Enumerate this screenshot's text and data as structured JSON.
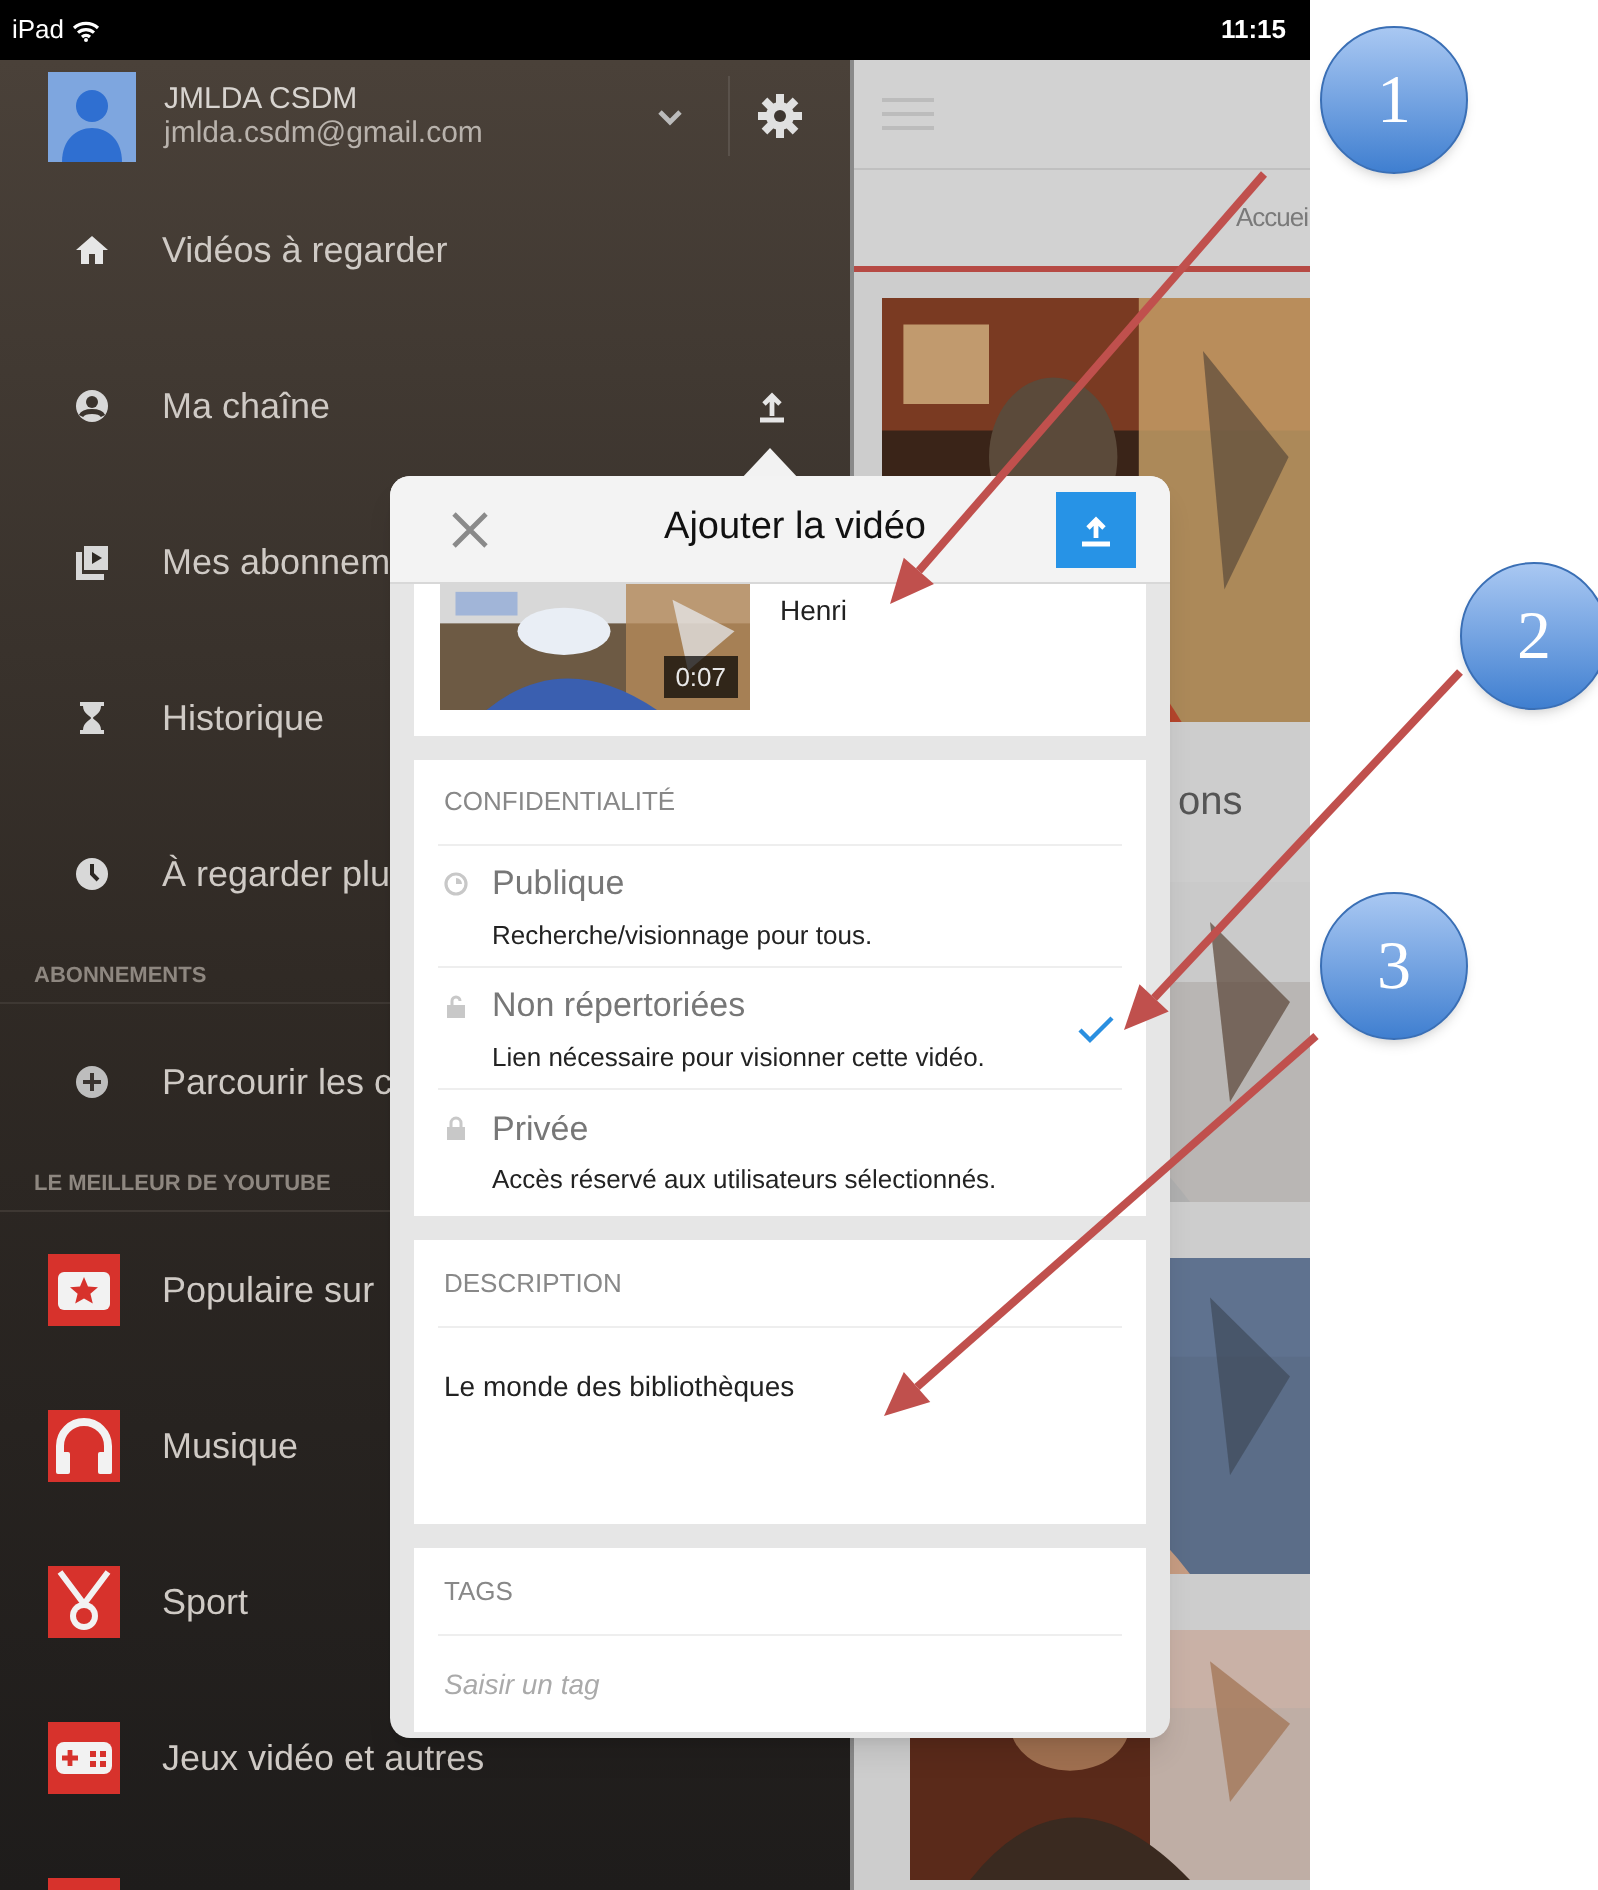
{
  "status_bar": {
    "device": "iPad",
    "time": "11:15"
  },
  "account": {
    "name": "JMLDA CSDM",
    "email": "jmlda.csdm@gmail.com"
  },
  "sidebar": {
    "items": [
      {
        "kind": "nav",
        "label": "Vidéos à regarder"
      },
      {
        "kind": "nav-upload",
        "label": "Ma chaîne"
      },
      {
        "kind": "nav",
        "label": "Mes abonnem"
      },
      {
        "kind": "nav",
        "label": "Historique"
      },
      {
        "kind": "nav",
        "label": "À regarder plu"
      },
      {
        "kind": "header",
        "label": "ABONNEMENTS"
      },
      {
        "kind": "nav",
        "label": "Parcourir les c"
      },
      {
        "kind": "header",
        "label": "LE MEILLEUR DE YOUTUBE"
      },
      {
        "kind": "channel",
        "label": "Populaire sur"
      },
      {
        "kind": "channel",
        "label": "Musique"
      },
      {
        "kind": "channel",
        "label": "Sport"
      },
      {
        "kind": "channel",
        "label": "Jeux vidéo et autres"
      },
      {
        "kind": "channel"
      }
    ]
  },
  "main": {
    "tab": "Accuei",
    "section_title": "ons"
  },
  "dialog": {
    "title": "Ajouter la vidéo",
    "video": {
      "title": "Henri",
      "duration": "0:07"
    },
    "privacy": {
      "heading": "CONFIDENTIALITÉ",
      "options": [
        {
          "label": "Publique",
          "description": "Recherche/visionnage pour tous.",
          "selected": false
        },
        {
          "label": "Non répertoriées",
          "description": "Lien nécessaire pour visionner cette vidéo.",
          "selected": true
        },
        {
          "label": "Privée",
          "description": "Accès réservé aux utilisateurs sélectionnés.",
          "selected": false
        }
      ]
    },
    "description": {
      "heading": "DESCRIPTION",
      "value": "Le monde des bibliothèques"
    },
    "tags": {
      "heading": "TAGS",
      "placeholder": "Saisir un tag"
    }
  },
  "callouts": [
    {
      "number": "1"
    },
    {
      "number": "2"
    },
    {
      "number": "3"
    }
  ]
}
